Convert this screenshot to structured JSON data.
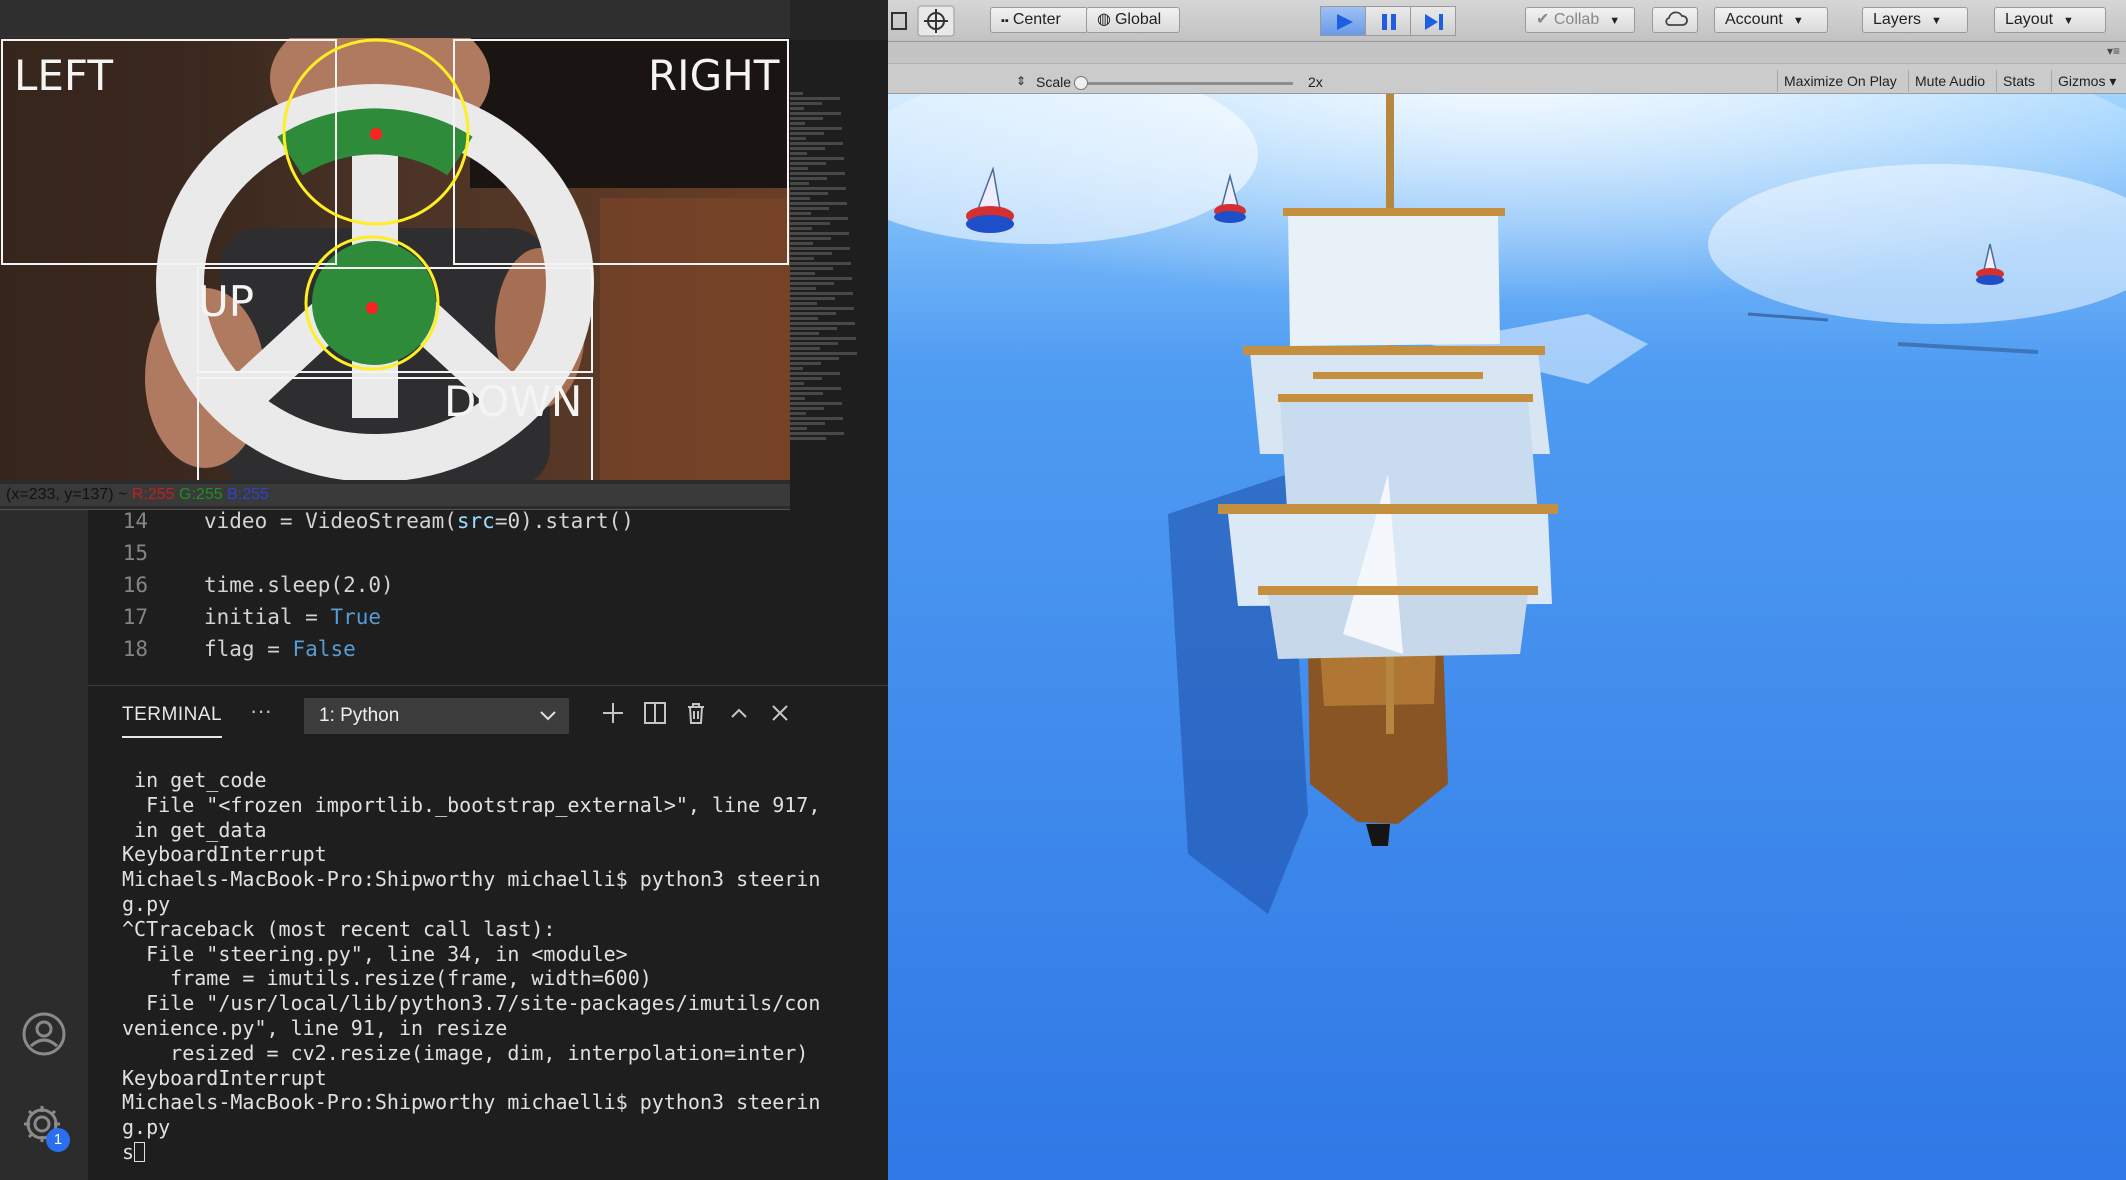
{
  "video_window": {
    "zones": {
      "left": "LEFT",
      "right": "RIGHT",
      "up": "UP",
      "down": "DOWN"
    },
    "status_coords": "(x=233, y=137) ~",
    "status_r": "R:255",
    "status_g": "G:255",
    "status_b": "B:255"
  },
  "editor": {
    "more_label": "···",
    "lines": [
      {
        "num": "14",
        "segments": [
          {
            "t": "video = VideoStream(",
            "c": "fn"
          },
          {
            "t": "src",
            "c": "arg"
          },
          {
            "t": "=0).start()",
            "c": "fn"
          }
        ]
      },
      {
        "num": "15",
        "segments": [
          {
            "t": "",
            "c": "fn"
          }
        ]
      },
      {
        "num": "16",
        "segments": [
          {
            "t": "time.sleep(2.0)",
            "c": "fn"
          }
        ]
      },
      {
        "num": "17",
        "segments": [
          {
            "t": "initial = ",
            "c": "fn"
          },
          {
            "t": "True",
            "c": "kw"
          }
        ]
      },
      {
        "num": "18",
        "segments": [
          {
            "t": "flag = ",
            "c": "fn"
          },
          {
            "t": "False",
            "c": "kw"
          }
        ]
      }
    ]
  },
  "panel": {
    "tab_terminal": "TERMINAL",
    "more": "···",
    "terminal_select": "1: Python",
    "output": [
      " in get_code",
      "  File \"<frozen importlib._bootstrap_external>\", line 917,",
      " in get_data",
      "KeyboardInterrupt",
      "Michaels-MacBook-Pro:Shipworthy michaelli$ python3 steerin",
      "g.py",
      "^CTraceback (most recent call last):",
      "  File \"steering.py\", line 34, in <module>",
      "    frame = imutils.resize(frame, width=600)",
      "  File \"/usr/local/lib/python3.7/site-packages/imutils/con",
      "venience.py\", line 91, in resize",
      "    resized = cv2.resize(image, dim, interpolation=inter)",
      "KeyboardInterrupt",
      "Michaels-MacBook-Pro:Shipworthy michaelli$ python3 steerin",
      "g.py"
    ],
    "prompt_input": "s"
  },
  "activity": {
    "settings_badge": "1"
  },
  "unity": {
    "toolbar": {
      "center": "Center",
      "global": "Global",
      "collab": "Collab",
      "account": "Account",
      "layers": "Layers",
      "layout": "Layout"
    },
    "gamebar": {
      "scale_label": "Scale",
      "scale_value": "2x",
      "scale_level": 0.0,
      "maximize": "Maximize On Play",
      "mute": "Mute Audio",
      "stats": "Stats",
      "gizmos": "Gizmos"
    }
  },
  "colors": {
    "accent_blue": "#2a6ff0",
    "sea": "#3a86ea",
    "green_zone": "#2e8b3a",
    "yellow_circle": "#ffee22"
  }
}
